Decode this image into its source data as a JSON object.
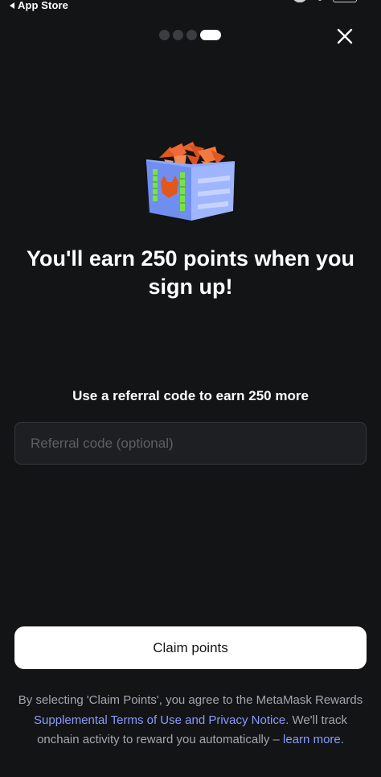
{
  "status_bar": {
    "back_label": "App Store"
  },
  "onboarding": {
    "step_count": 4,
    "active_step": 4
  },
  "headline": "You'll earn 250 points when you sign up!",
  "referral": {
    "prompt": "Use a referral code to earn 250 more",
    "placeholder": "Referral code (optional)",
    "value": ""
  },
  "claim_button_label": "Claim points",
  "legal": {
    "text_before": "By selecting 'Claim Points', you agree to the MetaMask Rewards ",
    "terms_link": "Supplemental Terms of Use and Privacy Notice.",
    "text_middle": " We'll track onchain activity to reward you automatically – ",
    "learn_more_link": "learn more."
  },
  "icons": {
    "close": "close-icon",
    "back": "back-caret-icon",
    "illustration": "rewards-box-illustration"
  },
  "colors": {
    "background": "#131416",
    "button_bg": "#ffffff",
    "link": "#8a9cff",
    "muted_text": "#a4a6ad"
  }
}
